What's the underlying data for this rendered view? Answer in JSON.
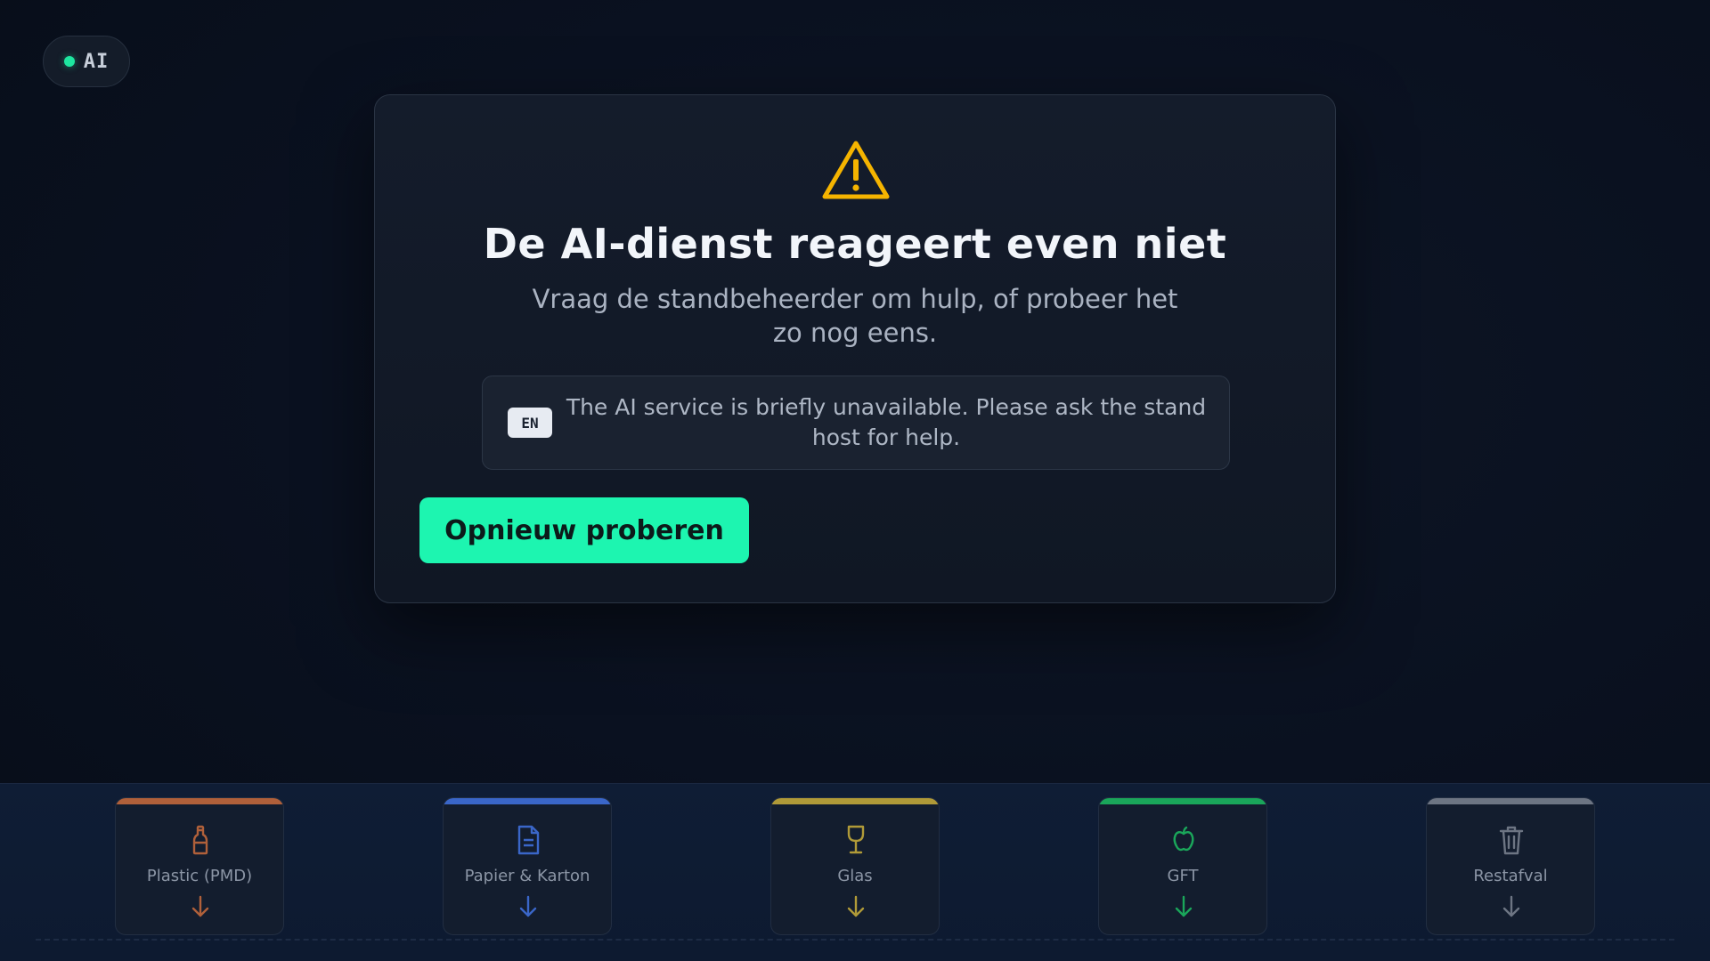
{
  "status": {
    "label": "AI",
    "dot_color": "#1ee6a0"
  },
  "modal": {
    "title": "De AI-dienst reageert even niet",
    "subtitle": "Vraag de standbeheerder om hulp, of probeer het zo nog eens.",
    "warning_icon": "warning-triangle-icon",
    "warning_color": "#f5b400",
    "translation": {
      "badge": "EN",
      "text": "The AI service is briefly unavailable. Please ask the stand host for help."
    },
    "retry_label": "Opnieuw proberen",
    "accent": "#1df5b0"
  },
  "bins": [
    {
      "label": "Plastic (PMD)",
      "icon": "bottle-icon",
      "color": "#b0603a"
    },
    {
      "label": "Papier & Karton",
      "icon": "document-icon",
      "color": "#3a66c8"
    },
    {
      "label": "Glas",
      "icon": "glass-icon",
      "color": "#b09a38"
    },
    {
      "label": "GFT",
      "icon": "apple-icon",
      "color": "#1aa65a"
    },
    {
      "label": "Restafval",
      "icon": "trash-icon",
      "color": "#6d7583"
    }
  ]
}
